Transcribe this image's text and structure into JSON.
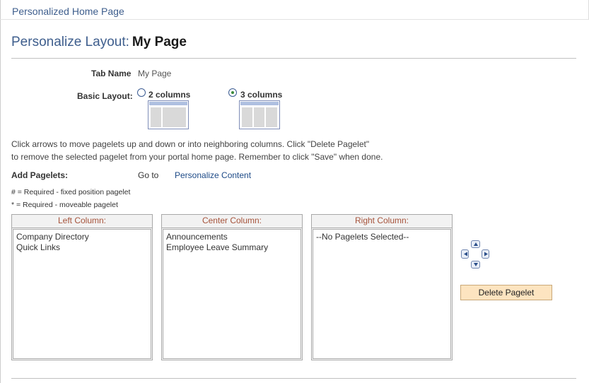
{
  "breadcrumb": "Personalized Home Page",
  "title": {
    "prefix": "Personalize Layout:",
    "page_name": "My Page"
  },
  "tab_name": {
    "label": "Tab Name",
    "value": "My Page"
  },
  "basic_layout": {
    "label": "Basic Layout:",
    "options": [
      {
        "label": "2 columns",
        "selected": false
      },
      {
        "label": "3 columns",
        "selected": true
      }
    ]
  },
  "instructions": [
    "Click arrows to move pagelets up and down or into neighboring columns. Click \"Delete Pagelet\"",
    "to remove the selected pagelet from your portal home page. Remember to click \"Save\" when done."
  ],
  "add_pagelets": {
    "label": "Add Pagelets:",
    "goto": "Go to",
    "link": "Personalize Content"
  },
  "notes": [
    "# = Required - fixed position pagelet",
    "* = Required - moveable pagelet"
  ],
  "columns": [
    {
      "header": "Left Column:",
      "items": [
        "Company Directory",
        "Quick Links"
      ]
    },
    {
      "header": "Center Column:",
      "items": [
        "Announcements",
        "Employee Leave Summary"
      ]
    },
    {
      "header": "Right Column:",
      "items": [
        "--No Pagelets Selected--"
      ]
    }
  ],
  "arrows": [
    "arrow-up-icon",
    "arrow-left-icon",
    "arrow-right-icon",
    "arrow-down-icon"
  ],
  "delete_button": "Delete Pagelet",
  "colors": {
    "title": "#3e5e8d",
    "column_header": "#a6533b",
    "button_bg": "#fde4c0",
    "link": "#1d4a87"
  }
}
